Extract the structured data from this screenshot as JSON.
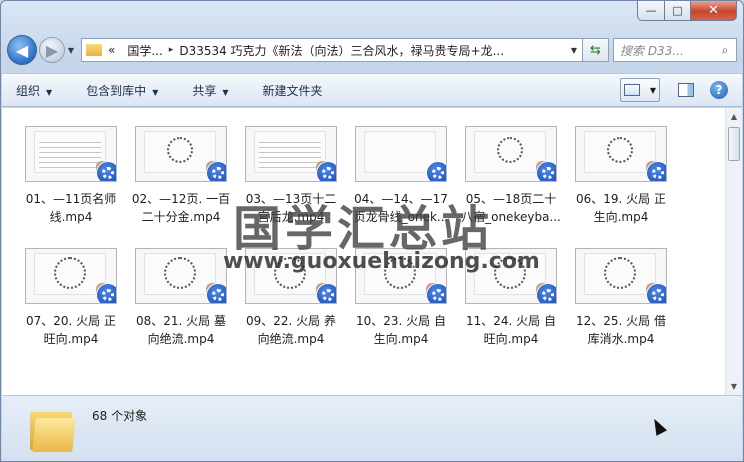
{
  "window": {
    "minimize_glyph": "—",
    "maximize_glyph": "□",
    "close_glyph": "✕"
  },
  "nav": {
    "back_glyph": "◀",
    "forward_glyph": "▶",
    "breadcrumb": [
      "«",
      "国学...",
      "▸",
      "D33534 巧克力《新法（向法）三合风水，禄马贵专局+龙..."
    ],
    "search_placeholder": "搜索 D33..."
  },
  "toolbar": {
    "organize": "组织",
    "include_in_library": "包含到库中",
    "share": "共享",
    "new_folder": "新建文件夹"
  },
  "files": [
    {
      "name": "01、—11页名师线.mp4",
      "style": "lines"
    },
    {
      "name": "02、—12页. 一百二十分金.mp4",
      "style": "circle"
    },
    {
      "name": "03、—13页十二宫后龙.mp4",
      "style": "lines"
    },
    {
      "name": "04、—14、—17页龙骨线_onek...",
      "style": "white"
    },
    {
      "name": "05、—18页二十八宿_onekeyba...",
      "style": "circle"
    },
    {
      "name": "06、19. 火局 正生向.mp4",
      "style": "circle"
    },
    {
      "name": "07、20. 火局 正旺向.mp4",
      "style": "big"
    },
    {
      "name": "08、21. 火局 墓向绝流.mp4",
      "style": "big"
    },
    {
      "name": "09、22. 火局 养向绝流.mp4",
      "style": "big"
    },
    {
      "name": "10、23. 火局 自生向.mp4",
      "style": "big"
    },
    {
      "name": "11、24. 火局 自旺向.mp4",
      "style": "big"
    },
    {
      "name": "12、25. 火局 借库消水.mp4",
      "style": "big"
    }
  ],
  "watermark": {
    "title": "国学汇总站",
    "url": "www.guoxuehuizong.com"
  },
  "details": {
    "count": "68 个对象"
  }
}
